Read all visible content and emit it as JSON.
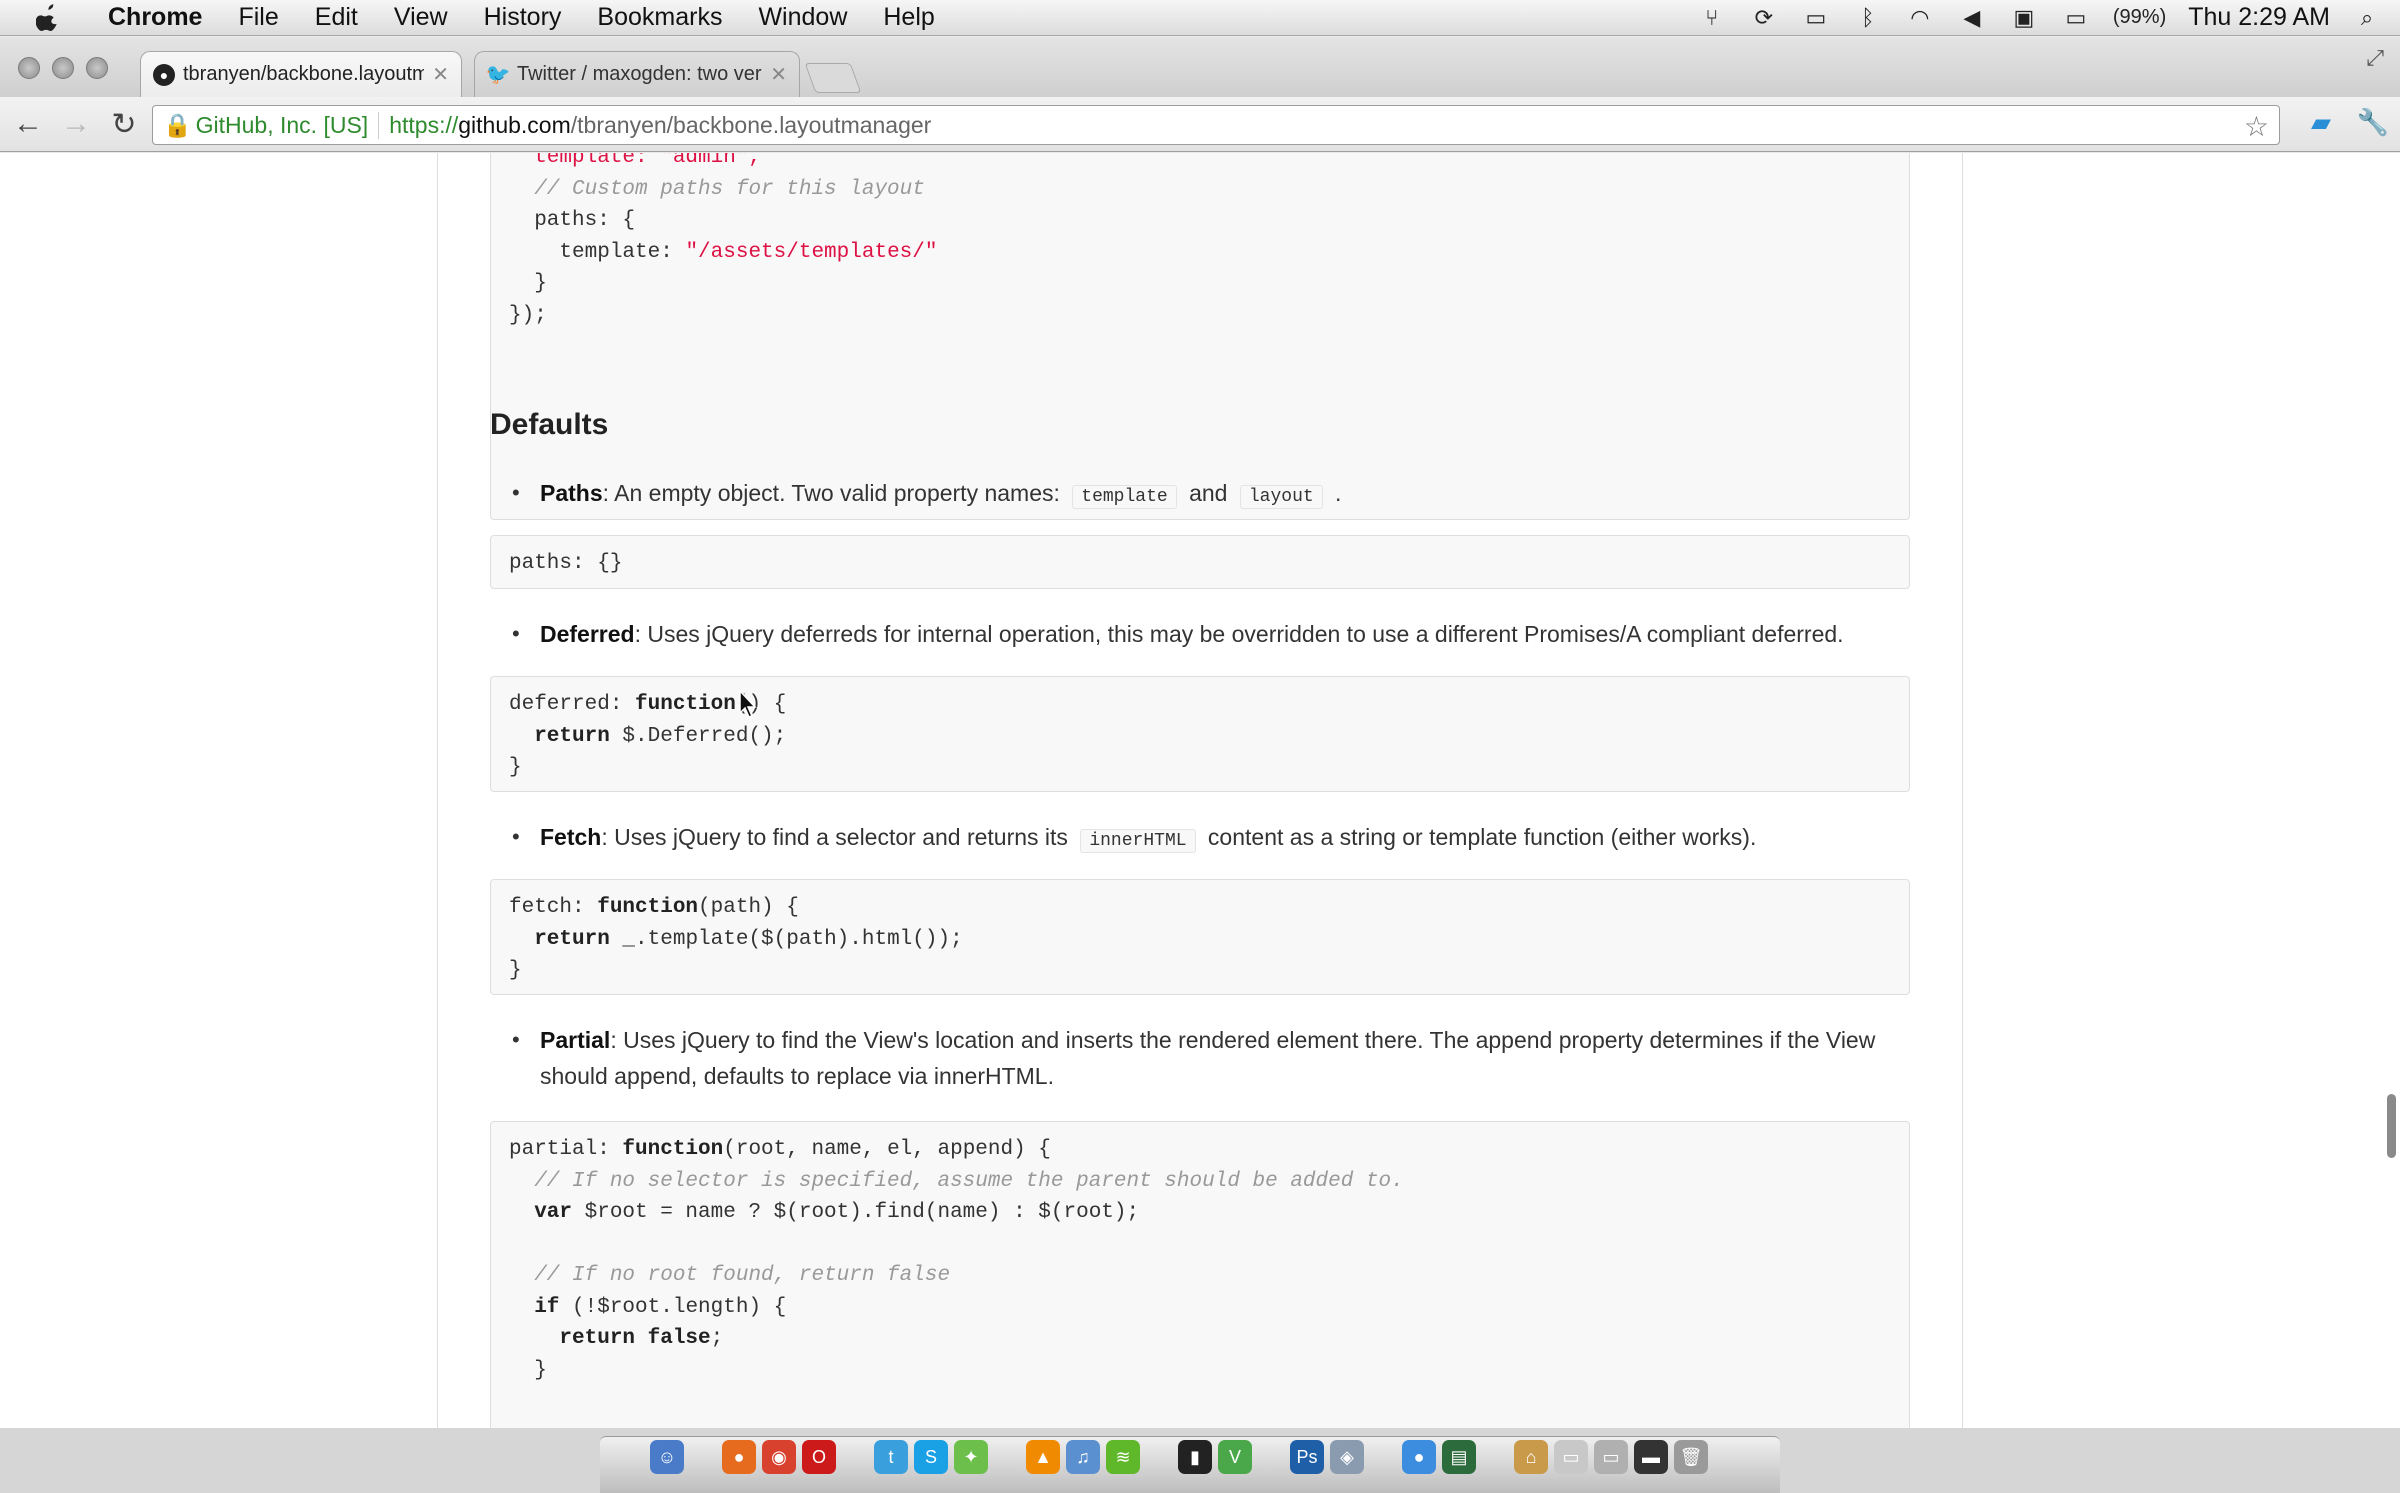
{
  "menubar": {
    "app_name": "Chrome",
    "items": [
      "File",
      "Edit",
      "View",
      "History",
      "Bookmarks",
      "Window",
      "Help"
    ],
    "battery": "(99%)",
    "clock": "Thu 2:29 AM"
  },
  "tabs": [
    {
      "label": "tbranyen/backbone.layoutm",
      "icon": "github-icon",
      "active": true
    },
    {
      "label": "Twitter / maxogden: two ver",
      "icon": "twitter-icon",
      "active": false
    }
  ],
  "toolbar": {
    "ev_label": "GitHub, Inc. [US]",
    "url_scheme": "https://",
    "url_host": "github.com",
    "url_path": "/tbranyen/backbone.layoutmanager"
  },
  "content": {
    "top_code": {
      "line0": "  template: \"admin\",",
      "comment": "  // Custom paths for this layout",
      "paths_open": "  paths: {",
      "template_key": "    template: ",
      "template_val": "\"/assets/templates/\"",
      "paths_close": "  }",
      "end": "});"
    },
    "heading": "Defaults",
    "paths": {
      "term": "Paths",
      "text1": ": An empty object. Two valid property names: ",
      "code1": "template",
      "and": " and ",
      "code2": "layout",
      "end": " .",
      "code": "paths: {}"
    },
    "deferred": {
      "term": "Deferred",
      "text": ": Uses jQuery deferreds for internal operation, this may be overridden to use a different Promises/A compliant deferred.",
      "l1a": "deferred: ",
      "l1kw": "function",
      "l1b": "() {",
      "l2kw": "  return",
      "l2b": " $.Deferred();",
      "l3": "}"
    },
    "fetch": {
      "term": "Fetch",
      "text1": ": Uses jQuery to find a selector and returns its ",
      "code": "innerHTML",
      "text2": " content as a string or template function (either works).",
      "l1a": "fetch: ",
      "l1kw": "function",
      "l1b": "(path) {",
      "l2kw": "  return",
      "l2b": " _.template($(path).html());",
      "l3": "}"
    },
    "partial": {
      "term": "Partial",
      "text": ": Uses jQuery to find the View's location and inserts the rendered element there. The append property determines if the View should append, defaults to replace via innerHTML.",
      "l1a": "partial: ",
      "l1kw": "function",
      "l1b": "(root, name, el, append) {",
      "l2": "  // If no selector is specified, assume the parent should be added to.",
      "l3kw": "  var",
      "l3b": " $root = name ? $(root).find(name) : $(root);",
      "l5": "  // If no root found, return false",
      "l6kw": "  if",
      "l6b": " (!$root.length) {",
      "l7kw": "    return false",
      "l7b": ";",
      "l8": "  }"
    }
  },
  "colors": {
    "code_bg": "#f8f8f8",
    "string": "#dd1144",
    "comment": "#999999",
    "ev_green": "#2e8b2e"
  }
}
